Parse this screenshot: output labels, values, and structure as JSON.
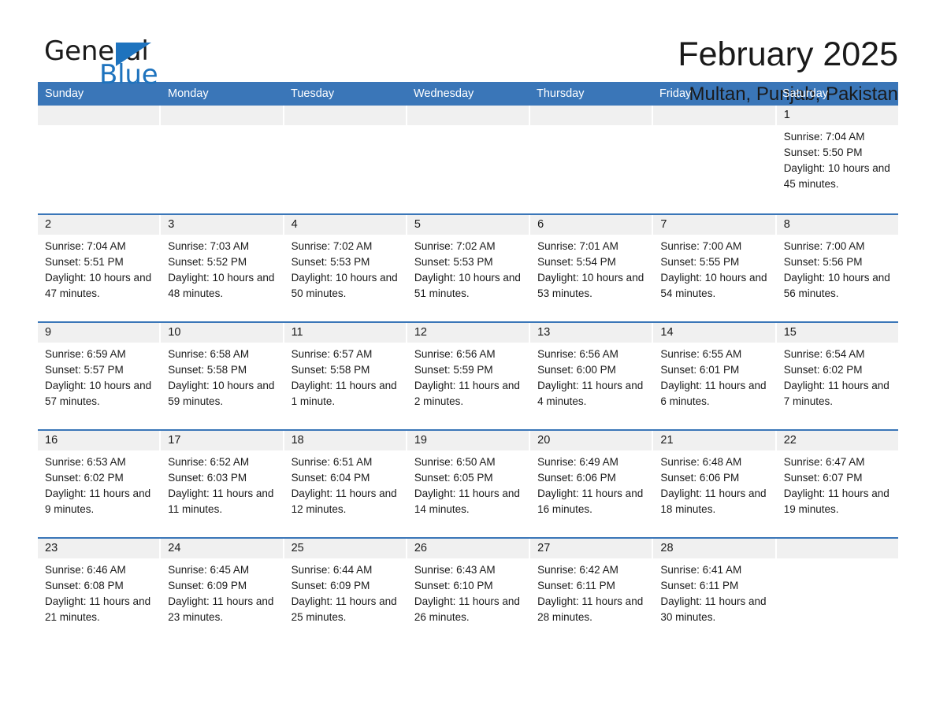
{
  "logo": {
    "text_primary": "General",
    "text_secondary": "Blue",
    "triangle_color": "#1e73be"
  },
  "header": {
    "month_title": "February 2025",
    "location": "Multan, Punjab, Pakistan"
  },
  "theme": {
    "header_blue": "#3a76b8",
    "row_border_blue": "#3a76b8",
    "day_number_band": "#f0f0f0",
    "text_color": "#1a1a1a"
  },
  "calendar": {
    "weekdays": [
      "Sunday",
      "Monday",
      "Tuesday",
      "Wednesday",
      "Thursday",
      "Friday",
      "Saturday"
    ],
    "weeks": [
      [
        {
          "day": "",
          "empty": true
        },
        {
          "day": "",
          "empty": true
        },
        {
          "day": "",
          "empty": true
        },
        {
          "day": "",
          "empty": true
        },
        {
          "day": "",
          "empty": true
        },
        {
          "day": "",
          "empty": true
        },
        {
          "day": "1",
          "sunrise": "Sunrise: 7:04 AM",
          "sunset": "Sunset: 5:50 PM",
          "daylight": "Daylight: 10 hours and 45 minutes."
        }
      ],
      [
        {
          "day": "2",
          "sunrise": "Sunrise: 7:04 AM",
          "sunset": "Sunset: 5:51 PM",
          "daylight": "Daylight: 10 hours and 47 minutes."
        },
        {
          "day": "3",
          "sunrise": "Sunrise: 7:03 AM",
          "sunset": "Sunset: 5:52 PM",
          "daylight": "Daylight: 10 hours and 48 minutes."
        },
        {
          "day": "4",
          "sunrise": "Sunrise: 7:02 AM",
          "sunset": "Sunset: 5:53 PM",
          "daylight": "Daylight: 10 hours and 50 minutes."
        },
        {
          "day": "5",
          "sunrise": "Sunrise: 7:02 AM",
          "sunset": "Sunset: 5:53 PM",
          "daylight": "Daylight: 10 hours and 51 minutes."
        },
        {
          "day": "6",
          "sunrise": "Sunrise: 7:01 AM",
          "sunset": "Sunset: 5:54 PM",
          "daylight": "Daylight: 10 hours and 53 minutes."
        },
        {
          "day": "7",
          "sunrise": "Sunrise: 7:00 AM",
          "sunset": "Sunset: 5:55 PM",
          "daylight": "Daylight: 10 hours and 54 minutes."
        },
        {
          "day": "8",
          "sunrise": "Sunrise: 7:00 AM",
          "sunset": "Sunset: 5:56 PM",
          "daylight": "Daylight: 10 hours and 56 minutes."
        }
      ],
      [
        {
          "day": "9",
          "sunrise": "Sunrise: 6:59 AM",
          "sunset": "Sunset: 5:57 PM",
          "daylight": "Daylight: 10 hours and 57 minutes."
        },
        {
          "day": "10",
          "sunrise": "Sunrise: 6:58 AM",
          "sunset": "Sunset: 5:58 PM",
          "daylight": "Daylight: 10 hours and 59 minutes."
        },
        {
          "day": "11",
          "sunrise": "Sunrise: 6:57 AM",
          "sunset": "Sunset: 5:58 PM",
          "daylight": "Daylight: 11 hours and 1 minute."
        },
        {
          "day": "12",
          "sunrise": "Sunrise: 6:56 AM",
          "sunset": "Sunset: 5:59 PM",
          "daylight": "Daylight: 11 hours and 2 minutes."
        },
        {
          "day": "13",
          "sunrise": "Sunrise: 6:56 AM",
          "sunset": "Sunset: 6:00 PM",
          "daylight": "Daylight: 11 hours and 4 minutes."
        },
        {
          "day": "14",
          "sunrise": "Sunrise: 6:55 AM",
          "sunset": "Sunset: 6:01 PM",
          "daylight": "Daylight: 11 hours and 6 minutes."
        },
        {
          "day": "15",
          "sunrise": "Sunrise: 6:54 AM",
          "sunset": "Sunset: 6:02 PM",
          "daylight": "Daylight: 11 hours and 7 minutes."
        }
      ],
      [
        {
          "day": "16",
          "sunrise": "Sunrise: 6:53 AM",
          "sunset": "Sunset: 6:02 PM",
          "daylight": "Daylight: 11 hours and 9 minutes."
        },
        {
          "day": "17",
          "sunrise": "Sunrise: 6:52 AM",
          "sunset": "Sunset: 6:03 PM",
          "daylight": "Daylight: 11 hours and 11 minutes."
        },
        {
          "day": "18",
          "sunrise": "Sunrise: 6:51 AM",
          "sunset": "Sunset: 6:04 PM",
          "daylight": "Daylight: 11 hours and 12 minutes."
        },
        {
          "day": "19",
          "sunrise": "Sunrise: 6:50 AM",
          "sunset": "Sunset: 6:05 PM",
          "daylight": "Daylight: 11 hours and 14 minutes."
        },
        {
          "day": "20",
          "sunrise": "Sunrise: 6:49 AM",
          "sunset": "Sunset: 6:06 PM",
          "daylight": "Daylight: 11 hours and 16 minutes."
        },
        {
          "day": "21",
          "sunrise": "Sunrise: 6:48 AM",
          "sunset": "Sunset: 6:06 PM",
          "daylight": "Daylight: 11 hours and 18 minutes."
        },
        {
          "day": "22",
          "sunrise": "Sunrise: 6:47 AM",
          "sunset": "Sunset: 6:07 PM",
          "daylight": "Daylight: 11 hours and 19 minutes."
        }
      ],
      [
        {
          "day": "23",
          "sunrise": "Sunrise: 6:46 AM",
          "sunset": "Sunset: 6:08 PM",
          "daylight": "Daylight: 11 hours and 21 minutes."
        },
        {
          "day": "24",
          "sunrise": "Sunrise: 6:45 AM",
          "sunset": "Sunset: 6:09 PM",
          "daylight": "Daylight: 11 hours and 23 minutes."
        },
        {
          "day": "25",
          "sunrise": "Sunrise: 6:44 AM",
          "sunset": "Sunset: 6:09 PM",
          "daylight": "Daylight: 11 hours and 25 minutes."
        },
        {
          "day": "26",
          "sunrise": "Sunrise: 6:43 AM",
          "sunset": "Sunset: 6:10 PM",
          "daylight": "Daylight: 11 hours and 26 minutes."
        },
        {
          "day": "27",
          "sunrise": "Sunrise: 6:42 AM",
          "sunset": "Sunset: 6:11 PM",
          "daylight": "Daylight: 11 hours and 28 minutes."
        },
        {
          "day": "28",
          "sunrise": "Sunrise: 6:41 AM",
          "sunset": "Sunset: 6:11 PM",
          "daylight": "Daylight: 11 hours and 30 minutes."
        },
        {
          "day": "",
          "empty": true
        }
      ]
    ]
  }
}
